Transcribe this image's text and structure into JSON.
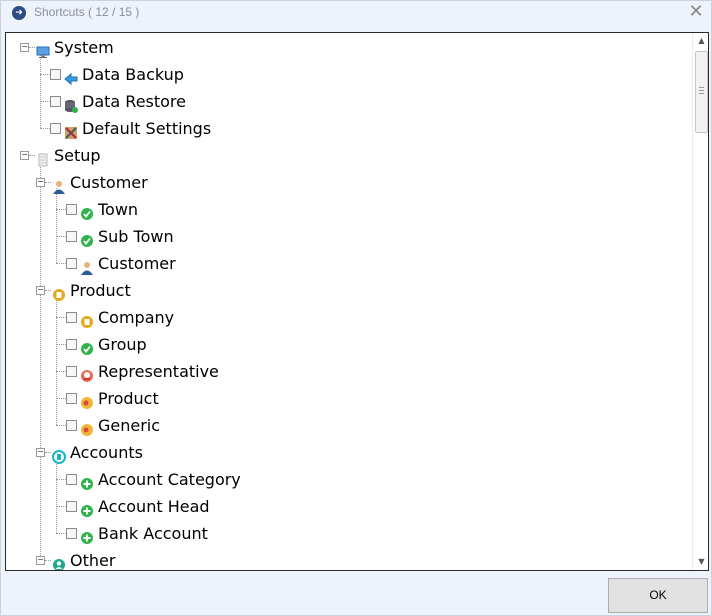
{
  "window": {
    "title": "Shortcuts ( 12 / 15 )",
    "close_glyph": "✕"
  },
  "tree": [
    {
      "label": "System",
      "level": 0,
      "expander": "−",
      "icon": "monitor-icon"
    },
    {
      "label": "Data Backup",
      "level": 1,
      "checkbox": true,
      "icon": "arrow-left-icon"
    },
    {
      "label": "Data Restore",
      "level": 1,
      "checkbox": true,
      "icon": "database-icon"
    },
    {
      "label": "Default Settings",
      "level": 1,
      "checkbox": true,
      "icon": "tools-icon"
    },
    {
      "label": "Setup",
      "level": 0,
      "expander": "−",
      "icon": "server-icon"
    },
    {
      "label": "Customer",
      "level": 1,
      "expander": "−",
      "icon": "person-icon"
    },
    {
      "label": "Town",
      "level": 2,
      "checkbox": true,
      "icon": "check-circle-icon"
    },
    {
      "label": "Sub Town",
      "level": 2,
      "checkbox": true,
      "icon": "check-circle-icon"
    },
    {
      "label": "Customer",
      "level": 2,
      "checkbox": true,
      "icon": "person-icon"
    },
    {
      "label": "Product",
      "level": 1,
      "expander": "−",
      "icon": "box-icon"
    },
    {
      "label": "Company",
      "level": 2,
      "checkbox": true,
      "icon": "box-icon"
    },
    {
      "label": "Group",
      "level": 2,
      "checkbox": true,
      "icon": "check-circle-icon"
    },
    {
      "label": "Representative",
      "level": 2,
      "checkbox": true,
      "icon": "representative-icon"
    },
    {
      "label": "Product",
      "level": 2,
      "checkbox": true,
      "icon": "pill-icon"
    },
    {
      "label": "Generic",
      "level": 2,
      "checkbox": true,
      "icon": "pill-icon"
    },
    {
      "label": "Accounts",
      "level": 1,
      "expander": "−",
      "icon": "accounts-icon"
    },
    {
      "label": "Account Category",
      "level": 2,
      "checkbox": true,
      "icon": "plus-circle-icon"
    },
    {
      "label": "Account Head",
      "level": 2,
      "checkbox": true,
      "icon": "plus-circle-icon"
    },
    {
      "label": "Bank Account",
      "level": 2,
      "checkbox": true,
      "icon": "plus-circle-icon"
    },
    {
      "label": "Other",
      "level": 1,
      "expander": "−",
      "icon": "user-circle-icon"
    }
  ],
  "scrollbar": {
    "up_glyph": "▲",
    "down_glyph": "▼"
  },
  "ok_button": {
    "label": "OK"
  },
  "colors": {
    "accent_green": "#2fb34a",
    "accent_blue": "#2a7fd4",
    "window_bg": "#eef3fb"
  }
}
